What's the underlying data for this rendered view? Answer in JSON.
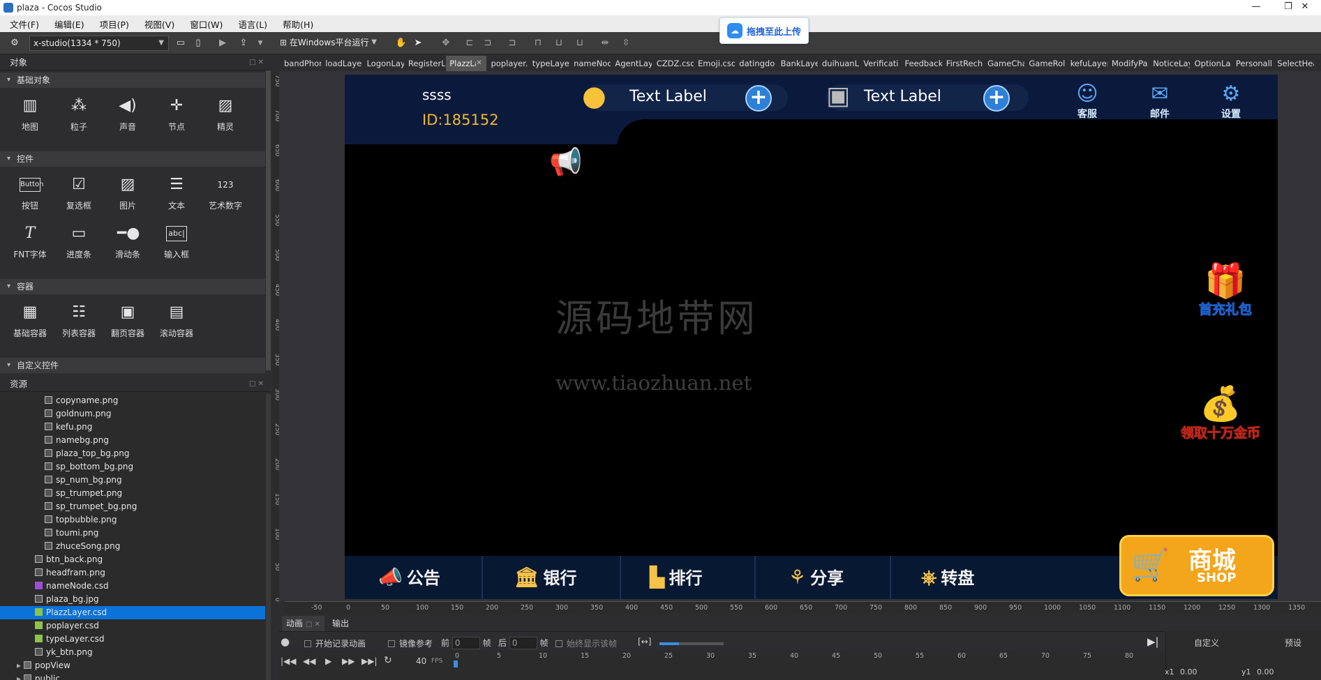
{
  "window": {
    "title": "plaza - Cocos Studio",
    "min": "—",
    "max": "❐",
    "close": "✕"
  },
  "menu": [
    "文件(F)",
    "编辑(E)",
    "项目(P)",
    "视图(V)",
    "窗口(W)",
    "语言(L)",
    "帮助(H)"
  ],
  "baidu_upload": {
    "label": "拖拽至此上传"
  },
  "toolbar": {
    "resolution": "x-studio(1334 * 750)",
    "run_label": "在Windows平台运行"
  },
  "objects_panel": {
    "title": "对象",
    "sections": [
      {
        "title": "基础对象",
        "items": [
          {
            "label": "地图",
            "icon": "map-icon"
          },
          {
            "label": "粒子",
            "icon": "particle-icon"
          },
          {
            "label": "声音",
            "icon": "sound-icon"
          },
          {
            "label": "节点",
            "icon": "node-icon"
          },
          {
            "label": "精灵",
            "icon": "sprite-icon"
          }
        ]
      },
      {
        "title": "控件",
        "items": [
          {
            "label": "按钮",
            "icon": "button-icon"
          },
          {
            "label": "复选框",
            "icon": "checkbox-icon"
          },
          {
            "label": "图片",
            "icon": "image-icon"
          },
          {
            "label": "文本",
            "icon": "text-icon"
          },
          {
            "label": "艺术数字",
            "icon": "atlas-number-icon"
          },
          {
            "label": "FNT字体",
            "icon": "fnt-font-icon"
          },
          {
            "label": "进度条",
            "icon": "progress-bar-icon"
          },
          {
            "label": "滑动条",
            "icon": "slider-icon"
          },
          {
            "label": "输入框",
            "icon": "input-box-icon"
          }
        ]
      },
      {
        "title": "容器",
        "items": [
          {
            "label": "基础容器",
            "icon": "panel-icon"
          },
          {
            "label": "列表容器",
            "icon": "list-view-icon"
          },
          {
            "label": "翻页容器",
            "icon": "page-view-icon"
          },
          {
            "label": "滚动容器",
            "icon": "scroll-view-icon"
          }
        ]
      },
      {
        "title": "自定义控件",
        "items": []
      }
    ]
  },
  "resources_panel": {
    "title": "资源",
    "items": [
      {
        "name": "copyname.png",
        "type": "png",
        "indent": 2
      },
      {
        "name": "goldnum.png",
        "type": "png",
        "indent": 2
      },
      {
        "name": "kefu.png",
        "type": "png",
        "indent": 2
      },
      {
        "name": "namebg.png",
        "type": "png",
        "indent": 2
      },
      {
        "name": "plaza_top_bg.png",
        "type": "png",
        "indent": 2
      },
      {
        "name": "sp_bottom_bg.png",
        "type": "png",
        "indent": 2
      },
      {
        "name": "sp_num_bg.png",
        "type": "png",
        "indent": 2
      },
      {
        "name": "sp_trumpet.png",
        "type": "png",
        "indent": 2
      },
      {
        "name": "sp_trumpet_bg.png",
        "type": "png",
        "indent": 2
      },
      {
        "name": "topbubble.png",
        "type": "png",
        "indent": 2
      },
      {
        "name": "toumi.png",
        "type": "png",
        "indent": 2
      },
      {
        "name": "zhuceSong.png",
        "type": "png",
        "indent": 2
      },
      {
        "name": "btn_back.png",
        "type": "png",
        "indent": 1
      },
      {
        "name": "headfram.png",
        "type": "png",
        "indent": 1
      },
      {
        "name": "nameNode.csd",
        "type": "csd-node",
        "indent": 1
      },
      {
        "name": "plaza_bg.jpg",
        "type": "png",
        "indent": 1
      },
      {
        "name": "PlazzLayer.csd",
        "type": "csd",
        "indent": 1,
        "selected": true
      },
      {
        "name": "poplayer.csd",
        "type": "csd",
        "indent": 1
      },
      {
        "name": "typeLayer.csd",
        "type": "csd",
        "indent": 1
      },
      {
        "name": "yk_btn.png",
        "type": "png",
        "indent": 1
      },
      {
        "name": "popView",
        "type": "folder",
        "indent": 0
      },
      {
        "name": "public",
        "type": "folder",
        "indent": 0
      }
    ]
  },
  "tabs": [
    "bandPhon",
    "loadLayer",
    "LogonLay",
    "RegisterL",
    "PlazzLa",
    "poplayer.c",
    "typeLayer",
    "nameNod",
    "AgentLay",
    "CZDZ.csd",
    "Emoji.csd",
    "datingdo",
    "BankLaye",
    "duihuanL",
    "Verificati",
    "Feedback",
    "FirstRech",
    "GameCha",
    "GameRol",
    "kefuLayer",
    "ModifyPa",
    "NoticeLay",
    "OptionLa",
    "Personalli",
    "SelectHea"
  ],
  "active_tab": 4,
  "active_tab_close": "✕",
  "game": {
    "player_name": "ssss",
    "player_id": "ID:185152",
    "bean_label": "Text Label",
    "safe_label": "Text Label",
    "plus": "+",
    "top_buttons": [
      {
        "label": "客服",
        "icon": "customer-service-icon"
      },
      {
        "label": "邮件",
        "icon": "mail-icon"
      },
      {
        "label": "设置",
        "icon": "settings-gear-icon"
      }
    ],
    "watermark_cn": "源码地带网",
    "watermark_url": "www.tiaozhuan.net",
    "first_recharge": "首充礼包",
    "free_gold": "领取十万金币",
    "bottom_buttons": [
      {
        "label": "公告",
        "icon": "megaphone-icon"
      },
      {
        "label": "银行",
        "icon": "bank-icon"
      },
      {
        "label": "排行",
        "icon": "ranking-icon"
      },
      {
        "label": "分享",
        "icon": "share-icon"
      },
      {
        "label": "转盘",
        "icon": "wheel-icon"
      }
    ],
    "shop_cn": "商城",
    "shop_en": "SHOP"
  },
  "ruler_h": [
    "-50",
    "0",
    "50",
    "100",
    "150",
    "200",
    "250",
    "300",
    "350",
    "400",
    "450",
    "500",
    "550",
    "600",
    "650",
    "700",
    "750",
    "800",
    "850",
    "900",
    "950",
    "1000",
    "1050",
    "1100",
    "1150",
    "1200",
    "1250",
    "1300",
    "1350",
    "14"
  ],
  "ruler_v": [
    "750",
    "700",
    "650",
    "600",
    "550",
    "500",
    "450",
    "400",
    "350",
    "300",
    "250",
    "200",
    "150",
    "100",
    "50",
    "0"
  ],
  "timeline": {
    "tabs": [
      "动画",
      "输出"
    ],
    "record_label": "开始记录动画",
    "mirror_label": "镜像参考",
    "front_label": "前",
    "back_label": "后",
    "front_val": "0",
    "back_val": "0",
    "frame_unit": "帧",
    "always_show": "始终显示该帧",
    "fps_val": "40",
    "fps_label": "FPS",
    "ticks": [
      "0",
      "5",
      "10",
      "15",
      "20",
      "25",
      "30",
      "35",
      "40",
      "45",
      "50",
      "55",
      "60",
      "65",
      "70",
      "75",
      "80"
    ],
    "custom_label": "自定义",
    "preset_label": "预设",
    "x1_label": "x1",
    "x1_val": "0.00",
    "y1_label": "y1",
    "y1_val": "0.00"
  }
}
